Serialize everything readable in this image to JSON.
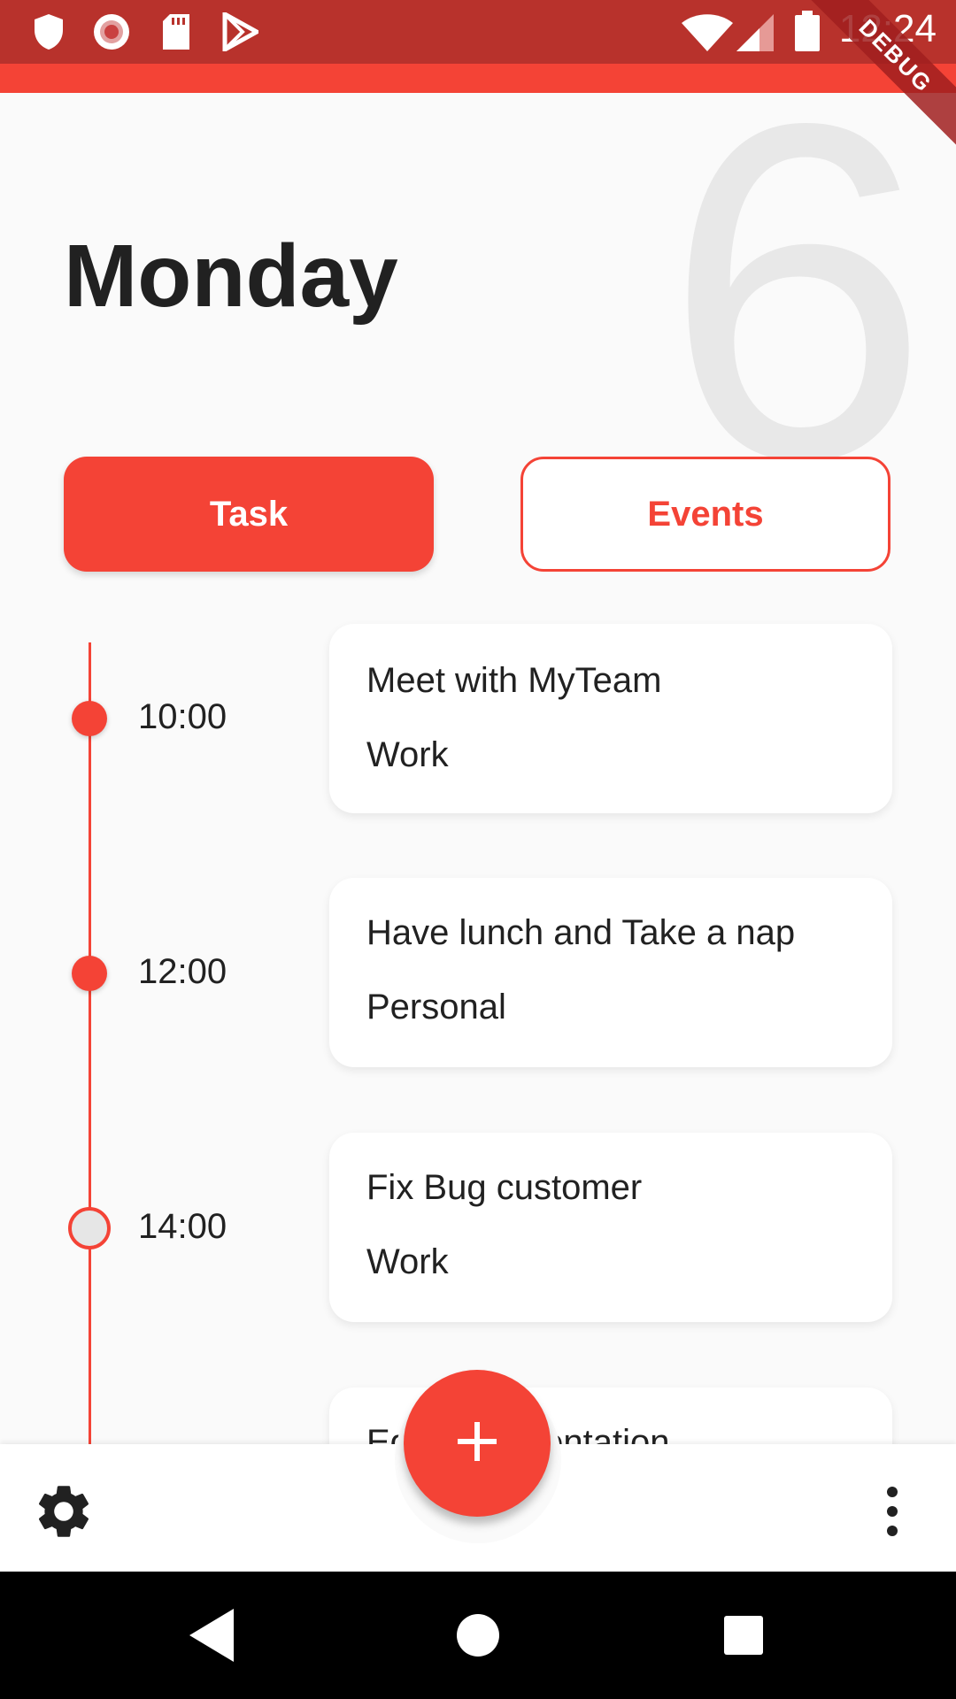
{
  "status_bar": {
    "time": "12:24",
    "left_icons": [
      "shield-icon",
      "record-icon",
      "sd-card-icon",
      "play-store-icon"
    ],
    "right_icons": [
      "wifi-icon",
      "signal-icon",
      "battery-icon"
    ],
    "debug_label": "DEBUG"
  },
  "header": {
    "date_number": "6",
    "day": "Monday"
  },
  "tabs": {
    "task_label": "Task",
    "events_label": "Events"
  },
  "timeline": [
    {
      "time": "10:00",
      "title": "Meet with MyTeam",
      "category": "Work",
      "done": true
    },
    {
      "time": "12:00",
      "title": "Have lunch and Take a nap",
      "category": "Personal",
      "done": true
    },
    {
      "time": "14:00",
      "title": "Fix Bug customer",
      "category": "Work",
      "done": false
    },
    {
      "title": "Edit documentation"
    }
  ],
  "colors": {
    "accent": "#f44336",
    "status_bar": "#b8322c"
  },
  "bottom_bar": {
    "left_icon": "settings-icon",
    "fab_icon": "add-icon",
    "right_icon": "more-vert-icon"
  },
  "nav_bar": {
    "icons": [
      "back-icon",
      "home-icon",
      "recents-icon"
    ]
  }
}
